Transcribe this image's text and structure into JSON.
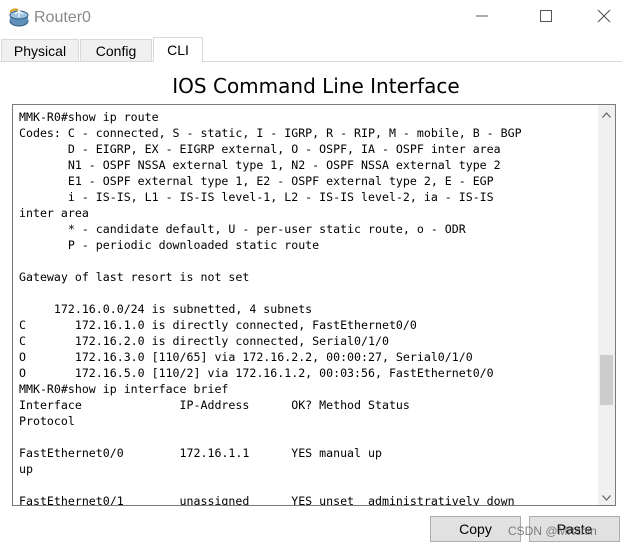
{
  "window": {
    "title": "Router0",
    "icon": "router-icon",
    "controls": [
      "minimize-icon",
      "maximize-icon",
      "close-icon"
    ]
  },
  "tabs": [
    {
      "label": "Physical",
      "active": false
    },
    {
      "label": "Config",
      "active": false
    },
    {
      "label": "CLI",
      "active": true
    }
  ],
  "panel": {
    "title": "IOS Command Line Interface"
  },
  "terminal": {
    "lines": [
      "MMK-R0#show ip route",
      "Codes: C - connected, S - static, I - IGRP, R - RIP, M - mobile, B - BGP",
      "       D - EIGRP, EX - EIGRP external, O - OSPF, IA - OSPF inter area",
      "       N1 - OSPF NSSA external type 1, N2 - OSPF NSSA external type 2",
      "       E1 - OSPF external type 1, E2 - OSPF external type 2, E - EGP",
      "       i - IS-IS, L1 - IS-IS level-1, L2 - IS-IS level-2, ia - IS-IS",
      "inter area",
      "       * - candidate default, U - per-user static route, o - ODR",
      "       P - periodic downloaded static route",
      "",
      "Gateway of last resort is not set",
      "",
      "     172.16.0.0/24 is subnetted, 4 subnets",
      "C       172.16.1.0 is directly connected, FastEthernet0/0",
      "C       172.16.2.0 is directly connected, Serial0/1/0",
      "O       172.16.3.0 [110/65] via 172.16.2.2, 00:00:27, Serial0/1/0",
      "O       172.16.5.0 [110/2] via 172.16.1.2, 00:03:56, FastEthernet0/0",
      "MMK-R0#show ip interface brief",
      "Interface              IP-Address      OK? Method Status",
      "Protocol",
      "",
      "FastEthernet0/0        172.16.1.1      YES manual up",
      "up",
      "",
      "FastEthernet0/1        unassigned      YES unset  administratively down"
    ]
  },
  "buttons": {
    "copy": "Copy",
    "paste": "Paste"
  },
  "watermark": "CSDN @Mrtchin"
}
